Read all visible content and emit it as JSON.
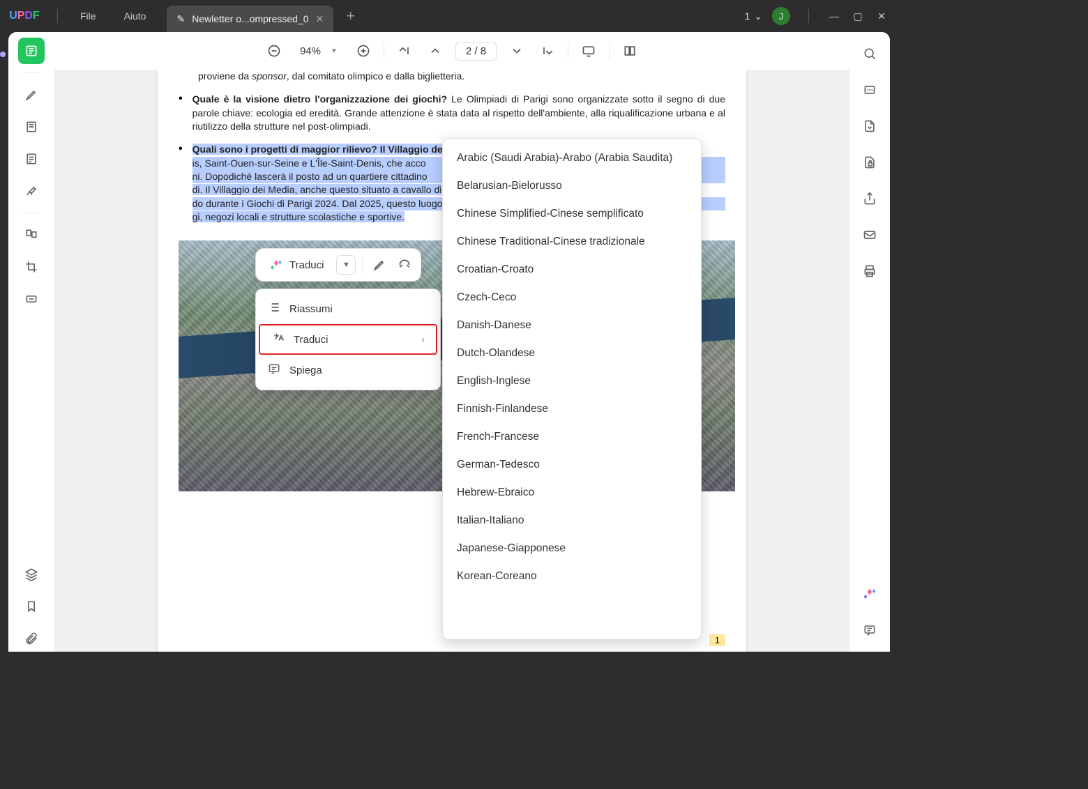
{
  "app": {
    "logo": "UPDF"
  },
  "menu": {
    "file": "File",
    "help": "Aiuto"
  },
  "tab": {
    "title": "Newletter o...ompressed_0"
  },
  "windows": {
    "count": "1"
  },
  "avatar": {
    "initial": "J"
  },
  "toolbar": {
    "zoom": "94%",
    "page": "2  /  8"
  },
  "doc": {
    "line0a": "proviene da ",
    "line0b": "sponsor",
    "line0c": ", dal comitato olimpico e dalla biglietteria.",
    "q1": "Quale è la visione dietro l'organizzazione dei giochi? ",
    "p1": "Le Olimpiadi di Parigi sono organizzate sotto il segno di due parole chiave: ecologia ed eredità. Grande attenzione è stata data al rispetto dell'ambiente, alla riqualificazione urbana e al riutilizzo della strutture nel post-olimpiadi.",
    "q2": "Quali sono i progetti di maggior rilievo? Il Villaggio degli At",
    "p2a": "is, Saint-Ouen-sur-Seine   e   L'Île-Saint-Denis,   che   acco",
    "p2b": "ni. Dopodiché  lascerà  il  posto  ad  un  quartiere  cittadino ",
    "p2c": "di. Il Villaggio dei Media",
    "p2d": ",  anche questo situato a cavallo di ",
    "p2e": "do durante  i  Giochi  di  Parigi  2024.  Dal  2025,  questo  luogo ",
    "p2f": "gi, negozi locali e strutture scolastiche e sportive.",
    "pagenum": "1"
  },
  "floatbar": {
    "translate": "Traduci"
  },
  "ctx": {
    "summarize": "Riassumi",
    "translate": "Traduci",
    "explain": "Spiega"
  },
  "lang": {
    "items": [
      "Arabic (Saudi Arabia)-Arabo (Arabia Saudita)",
      "Belarusian-Bielorusso",
      "Chinese Simplified-Cinese semplificato",
      "Chinese Traditional-Cinese tradizionale",
      "Croatian-Croato",
      "Czech-Ceco",
      "Danish-Danese",
      "Dutch-Olandese",
      "English-Inglese",
      "Finnish-Finlandese",
      "French-Francese",
      "German-Tedesco",
      "Hebrew-Ebraico",
      "Italian-Italiano",
      "Japanese-Giapponese",
      "Korean-Coreano"
    ]
  }
}
